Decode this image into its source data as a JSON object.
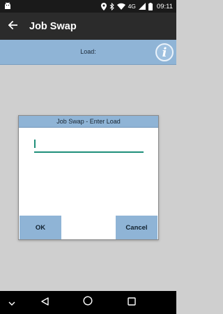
{
  "status_bar": {
    "time": "09:11",
    "network": "4G",
    "icons": [
      "android-icon",
      "location-icon",
      "bluetooth-icon",
      "wifi-icon",
      "cell-signal-icon",
      "battery-icon"
    ]
  },
  "app_bar": {
    "title": "Job Swap",
    "back_icon": "arrow-left-icon"
  },
  "info_bar": {
    "load_label": "Load:",
    "info_icon": "info-icon",
    "info_glyph": "i"
  },
  "dialog": {
    "title": "Job Swap - Enter Load",
    "input_value": "",
    "ok_label": "OK",
    "cancel_label": "Cancel"
  },
  "nav_bar": {
    "icons": [
      "chevron-down-icon",
      "back-triangle-icon",
      "home-circle-icon",
      "recents-square-icon"
    ]
  },
  "colors": {
    "accent_blue": "#8fb4d6",
    "input_underline": "#1f8f7a",
    "app_bar": "#2b2b2b",
    "background": "#cfcfcf"
  }
}
